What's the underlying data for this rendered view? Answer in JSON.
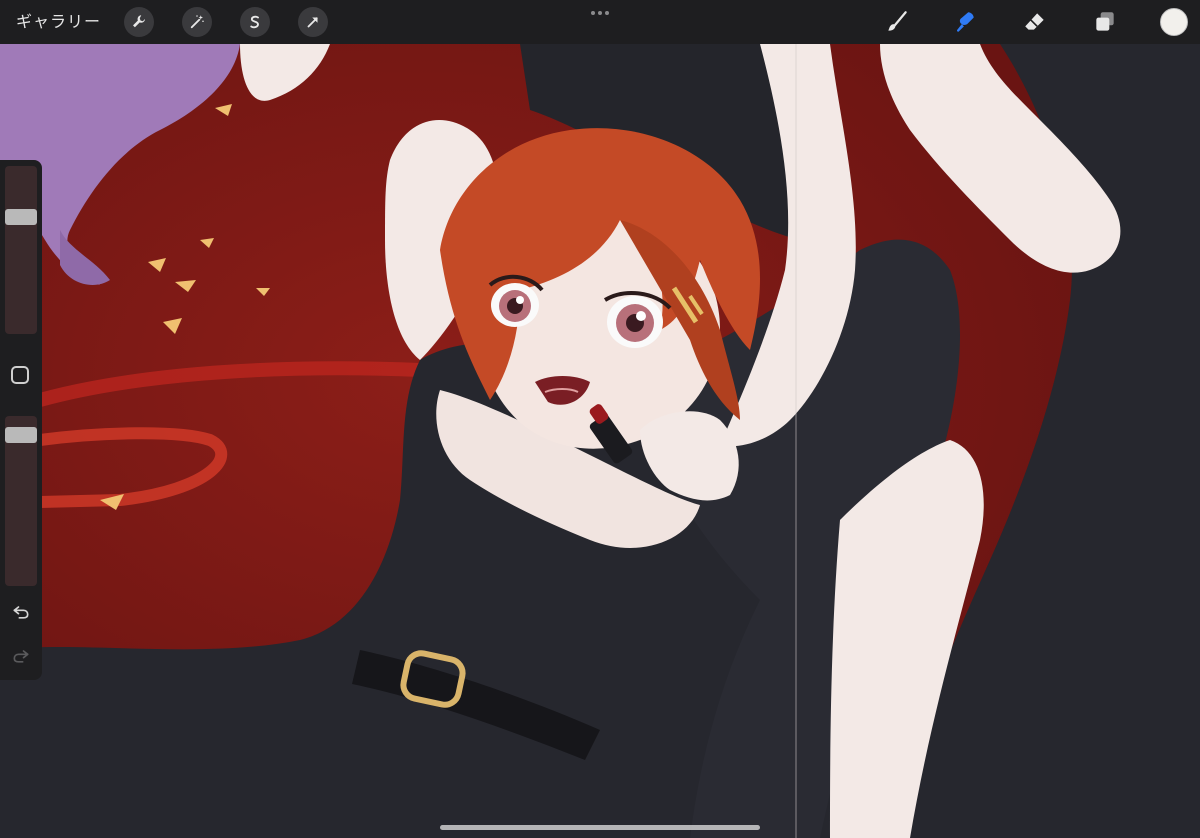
{
  "app": {
    "gallery_label": "ギャラリー"
  },
  "toolbar": {
    "left_tools": [
      {
        "icon": "wrench-icon",
        "name": "actions"
      },
      {
        "icon": "magic-wand-icon",
        "name": "adjustments"
      },
      {
        "icon": "selection-s-icon",
        "name": "selection"
      },
      {
        "icon": "arrow-cursor-icon",
        "name": "transform"
      }
    ],
    "right_tools": [
      {
        "icon": "brush-icon",
        "name": "paint",
        "active": false
      },
      {
        "icon": "smudge-icon",
        "name": "smudge",
        "active": true
      },
      {
        "icon": "eraser-icon",
        "name": "eraser",
        "active": false
      },
      {
        "icon": "layers-icon",
        "name": "layers",
        "active": false
      }
    ],
    "active_color": "#f2f0ec",
    "accent_color": "#2f7bf5"
  },
  "sidebar": {
    "brush_size_level": 0.72,
    "opacity_level": 0.93
  }
}
